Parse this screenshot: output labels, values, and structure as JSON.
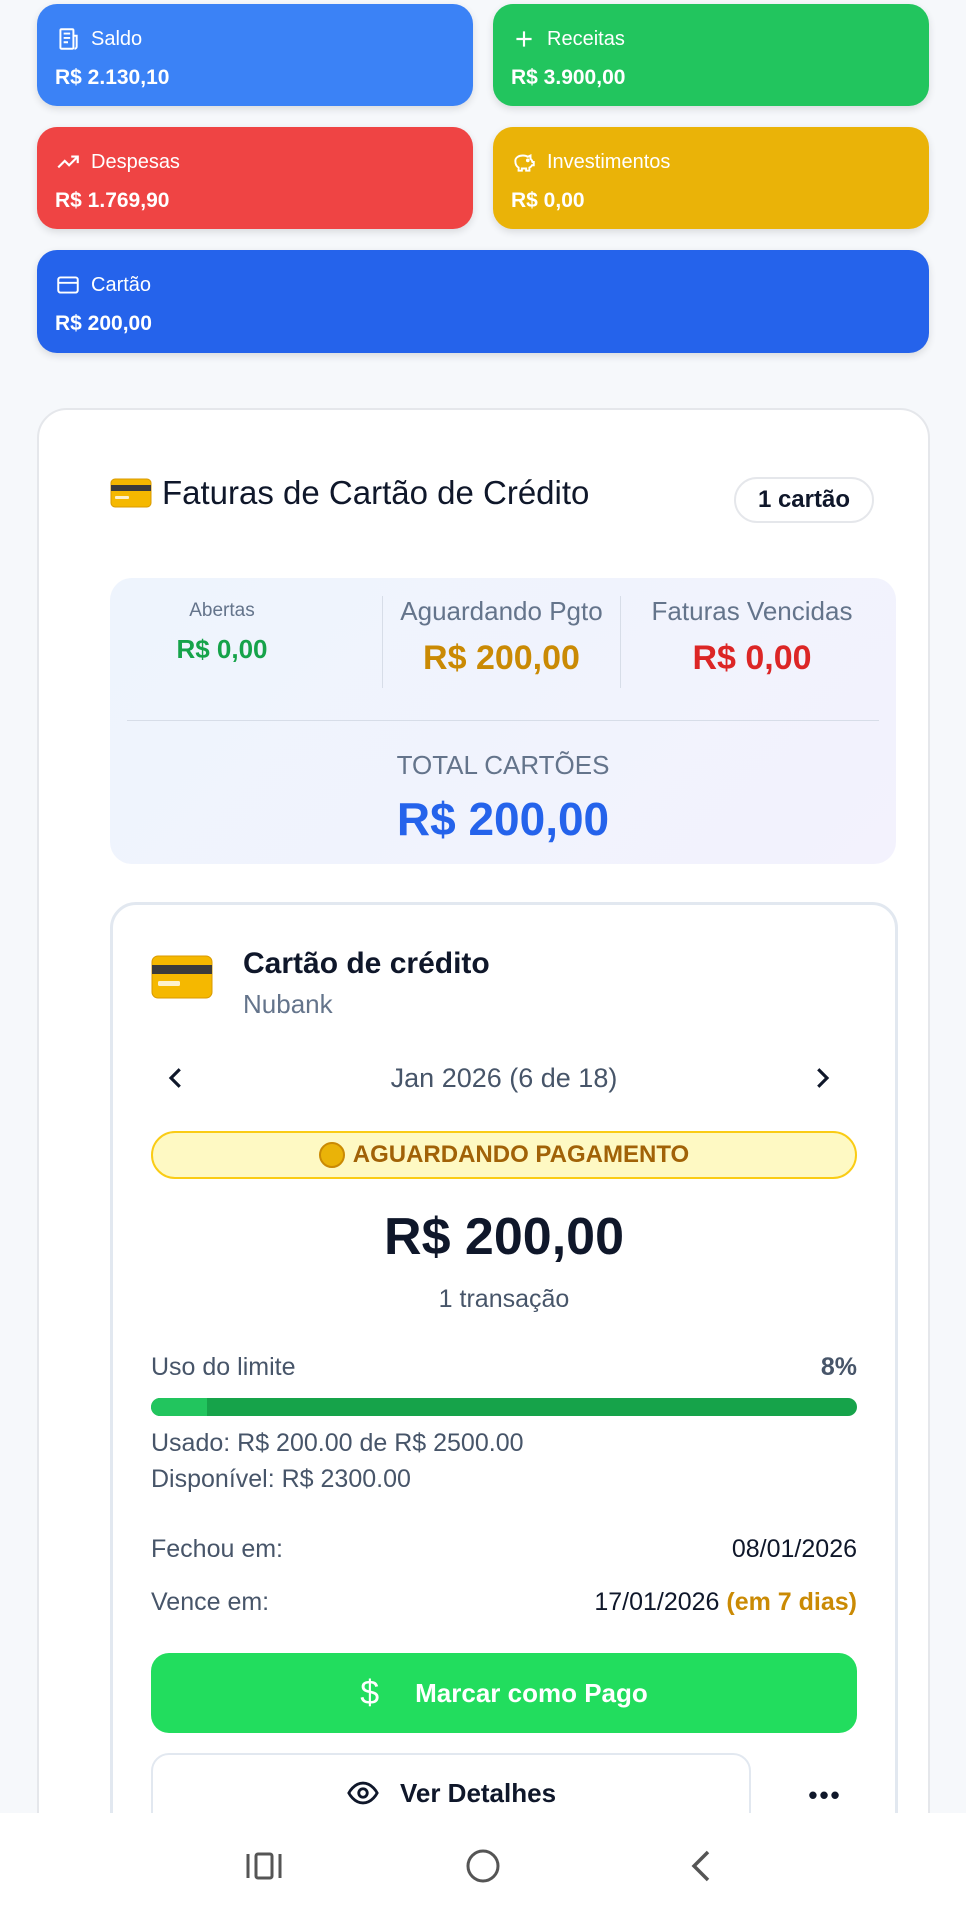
{
  "summary": {
    "saldo": {
      "label": "Saldo",
      "value": "R$ 2.130,10",
      "icon": "receipt-icon"
    },
    "receitas": {
      "label": "Receitas",
      "value": "R$ 3.900,00",
      "icon": "plus-icon"
    },
    "despesas": {
      "label": "Despesas",
      "value": "R$ 1.769,90",
      "icon": "trending-up-icon"
    },
    "investimentos": {
      "label": "Investimentos",
      "value": "R$ 0,00",
      "icon": "piggy-bank-icon"
    },
    "cartao": {
      "label": "Cartão",
      "value": "R$ 200,00",
      "icon": "credit-card-icon"
    }
  },
  "invoices": {
    "title": "Faturas de Cartão de Crédito",
    "count_label": "1 cartão",
    "stats": {
      "open_label": "Abertas",
      "open_value": "R$ 0,00",
      "awaiting_label": "Aguardando Pgto",
      "awaiting_value": "R$ 200,00",
      "overdue_label": "Faturas Vencidas",
      "overdue_value": "R$ 0,00",
      "total_label": "TOTAL CARTÕES",
      "total_value": "R$ 200,00"
    },
    "card": {
      "name": "Cartão de crédito",
      "bank": "Nubank",
      "period": "Jan 2026 (6 de 18)",
      "status": "AGUARDANDO PAGAMENTO",
      "amount": "R$ 200,00",
      "transactions": "1 transação",
      "limit_label": "Uso do limite",
      "limit_percent_label": "8%",
      "limit_fraction": 0.08,
      "used_text": "Usado: R$ 200.00 de R$ 2500.00",
      "available_text": "Disponível: R$ 2300.00",
      "closed_label": "Fechou em:",
      "closed_date": "08/01/2026",
      "due_label": "Vence em:",
      "due_date": "17/01/2026",
      "due_note": "(em 7 dias)",
      "pay_button": "Marcar como Pago",
      "details_button": "Ver Detalhes"
    }
  },
  "colors": {
    "saldo": "#3b82f6",
    "receitas": "#22c55e",
    "despesas": "#ef4444",
    "investimentos": "#eab308",
    "cartao": "#2563eb"
  }
}
